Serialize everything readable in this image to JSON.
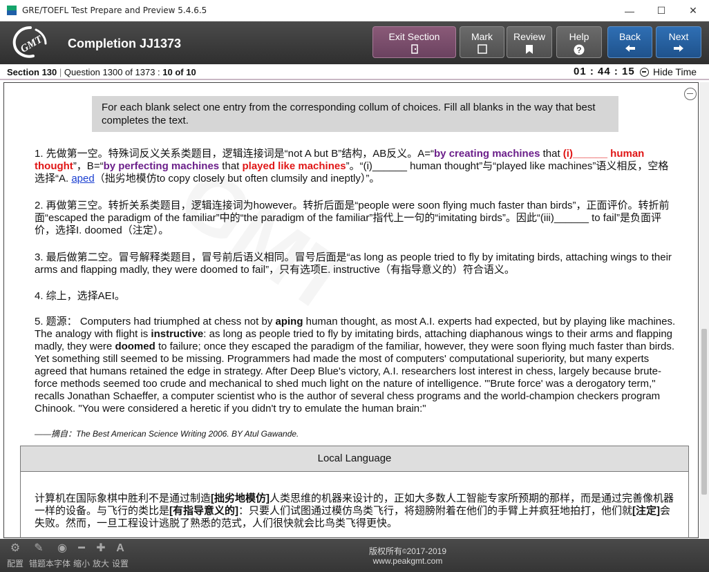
{
  "window": {
    "title": "GRE/TOEFL Test Prepare and Preview 5.4.6.5",
    "controls": [
      "—",
      "☐",
      "✕"
    ]
  },
  "header": {
    "logo_text": "GMT",
    "quiz_title": "Completion JJ1373",
    "buttons": {
      "exit_section": "Exit Section",
      "mark": "Mark",
      "review": "Review",
      "help": "Help",
      "back": "Back",
      "next": "Next"
    }
  },
  "status": {
    "section": "Section 130",
    "separator": " | ",
    "question": "Question 1300 of 1373 : ",
    "progress": "10 of 10",
    "timer": "01 : 44 : 15",
    "hide_time": "Hide Time"
  },
  "instructions": "For each blank select one entry from the corresponding collum of choices. Fill all blanks in the way that best completes the text.",
  "explanation": {
    "p1": {
      "a": "1. 先做第一空。特殊词反义关系类题目，逻辑连接词是“not A but B”结构，AB反义。A=“",
      "b": "by creating machines",
      "c": " that ",
      "d": "(i)______ human thought",
      "e": "”，B=“",
      "f": "by perfecting machines",
      "g": " that ",
      "h": "played like machines",
      "i": "”。“(i)______ human thought”与“played like machines”语义相反，空格选择“A. ",
      "j": "aped",
      "k": "（拙劣地模仿to copy closely but often clumsily and ineptly）”。"
    },
    "p2": "2. 再做第三空。转折关系类题目，逻辑连接词为however。转折后面是“people were soon flying much faster than birds”，正面评价。转折前面“escaped the paradigm of the familiar”中的“the paradigm of the familiar”指代上一句的“imitating birds”。因此“(iii)______ to fail”是负面评价，选择I. doomed（注定）。",
    "p3": "3. 最后做第二空。冒号解释类题目，冒号前后语义相同。冒号后面是“as long as people tried to fly by imitating birds, attaching wings to their arms and flapping madly, they were doomed to fail”，只有选项E. instructive（有指导意义的）符合语义。",
    "p4": "4. 综上，选择AEI。",
    "p5": {
      "a": "5. 题源： Computers had triumphed at chess not by ",
      "b": "aping",
      "c": " human thought, as most A.I. experts had expected, but by playing like machines. The analogy with flight is ",
      "d": "instructive",
      "e": ": as long as people tried to fly by imitating birds, attaching diaphanous wings to their arms and flapping madly, they were ",
      "f": "doomed",
      "g": " to failure; once they escaped the paradigm of the familiar, however, they were soon flying much faster than birds. Yet something still seemed to be missing. Programmers had made the most of computers' computational superiority, but many experts agreed that humans retained the edge in strategy. After Deep Blue's victory, A.I. researchers lost interest in chess, largely because brute-force methods seemed too crude and mechanical to shed much light on the nature of intelligence. \"'Brute force' was a derogatory term,\" recalls Jonathan Schaeffer, a computer scientist who is the author of several chess programs and the world-champion checkers program Chinook. \"You were considered a heretic if you didn't try to emulate the human brain:\""
    },
    "source": "——摘自：The Best American Science Writing 2006. BY Atul Gawande."
  },
  "local_language": {
    "label": "Local Language",
    "text": {
      "a": "计算机在国际象棋中胜利不是通过制造",
      "b": "[拙劣地模仿]",
      "c": "人类思维的机器来设计的，正如大多数人工智能专家所预期的那样，而是通过完善像机器一样的设备。与飞行的类比是",
      "d": "[有指导意义的]",
      "e": "：只要人们试图通过模仿鸟类飞行，将翅膀附着在他们的手臂上并疯狂地拍打，他们就",
      "f": "[注定]",
      "g": "会失败。然而，一旦工程设计逃脱了熟悉的范式，人们很快就会比鸟类飞得更快。"
    }
  },
  "footer": {
    "tools": [
      {
        "icon": "gear-icon",
        "label": "配置"
      },
      {
        "icon": "edit-icon",
        "label": "错题本"
      },
      {
        "icon": "font-icon",
        "label": "字体"
      },
      {
        "icon": "minus-icon",
        "label": "缩小"
      },
      {
        "icon": "plus-icon",
        "label": "放大"
      },
      {
        "icon": "settings-a-icon",
        "label": "设置"
      }
    ],
    "copyright_prefix": "版权所有",
    "copyright_years": "2017-2019",
    "website": "www.peakgmt.com"
  }
}
